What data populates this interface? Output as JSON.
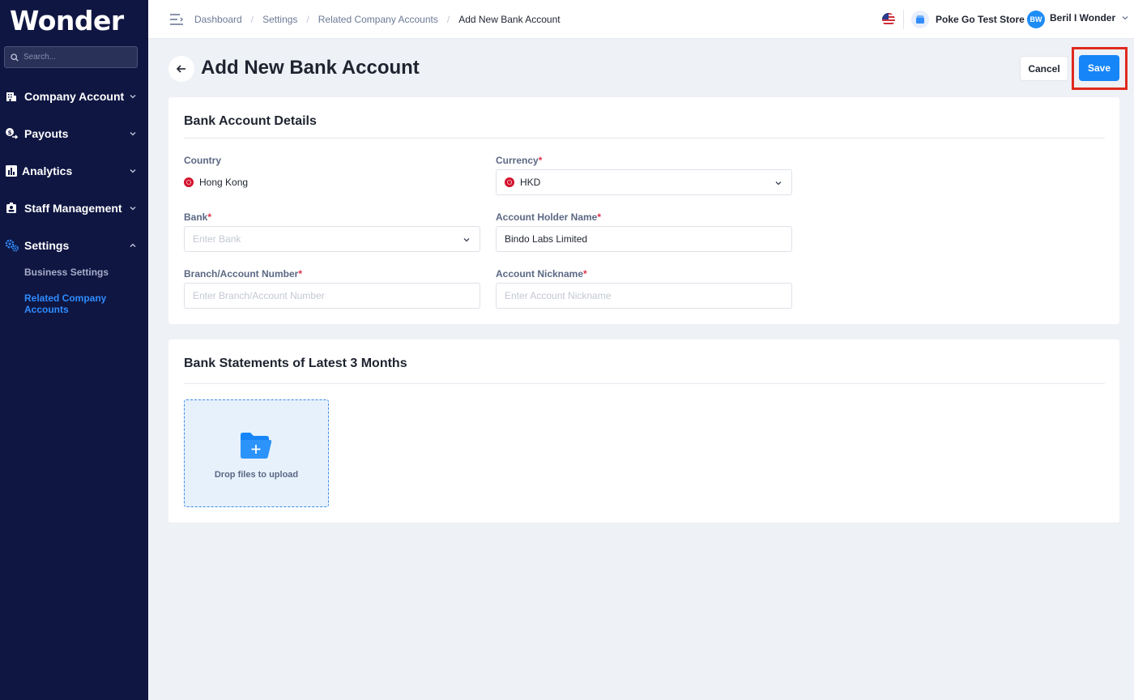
{
  "app": {
    "logo": "Wonder"
  },
  "sidebar": {
    "search_placeholder": "Search...",
    "items": [
      {
        "label": "Company Account",
        "icon": "building-icon"
      },
      {
        "label": "Payouts",
        "icon": "payout-icon"
      },
      {
        "label": "Analytics",
        "icon": "bar-chart-icon"
      },
      {
        "label": "Staff Management",
        "icon": "staff-icon"
      },
      {
        "label": "Settings",
        "icon": "gears-icon",
        "expanded": true
      }
    ],
    "sub_items": [
      {
        "label": "Business Settings",
        "active": false
      },
      {
        "label": "Related Company Accounts",
        "active": true
      }
    ]
  },
  "topbar": {
    "breadcrumb": [
      "Dashboard",
      "Settings",
      "Related Company Accounts",
      "Add New Bank Account"
    ],
    "store_name": "Poke Go Test Store",
    "user_initials": "BW",
    "user_name": "Beril I Wonder"
  },
  "page": {
    "title": "Add New Bank Account",
    "cancel_label": "Cancel",
    "save_label": "Save"
  },
  "bank_details": {
    "title": "Bank Account Details",
    "country_label": "Country",
    "country_value": "Hong Kong",
    "currency_label": "Currency",
    "currency_value": "HKD",
    "bank_label": "Bank",
    "bank_placeholder": "Enter Bank",
    "holder_label": "Account Holder Name",
    "holder_value": "Bindo Labs Limited",
    "branch_label": "Branch/Account Number",
    "branch_placeholder": "Enter Branch/Account Number",
    "nickname_label": "Account Nickname",
    "nickname_placeholder": "Enter Account Nickname",
    "required_mark": "*"
  },
  "statements": {
    "title": "Bank Statements of Latest 3 Months",
    "drop_label": "Drop files to upload"
  },
  "colors": {
    "sidebar_bg": "#0f1642",
    "accent": "#1685f8",
    "highlight": "#e02a1f"
  }
}
